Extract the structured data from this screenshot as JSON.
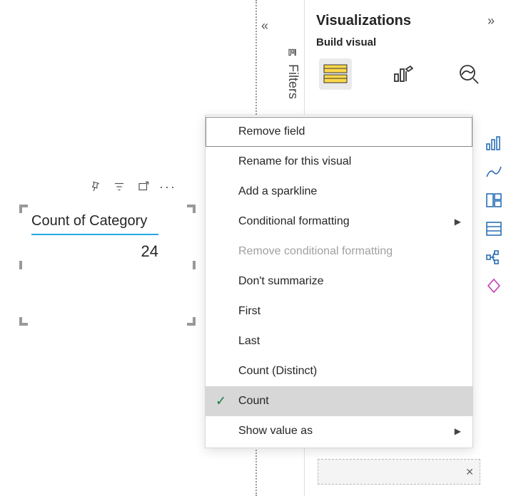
{
  "panel": {
    "title": "Visualizations",
    "build_label": "Build visual",
    "filters_label": "Filters"
  },
  "card": {
    "title": "Count of Category",
    "value": "24"
  },
  "chart_data": {
    "type": "table",
    "title": "Count of Category",
    "columns": [
      "Count of Category"
    ],
    "rows": [
      [
        24
      ]
    ]
  },
  "menu": {
    "items": {
      "remove_field": "Remove field",
      "rename": "Rename for this visual",
      "sparkline": "Add a sparkline",
      "conditional_formatting": "Conditional formatting",
      "remove_conditional": "Remove conditional formatting",
      "dont_summarize": "Don't summarize",
      "first": "First",
      "last": "Last",
      "count_distinct": "Count (Distinct)",
      "count": "Count",
      "show_value_as": "Show value as"
    }
  }
}
